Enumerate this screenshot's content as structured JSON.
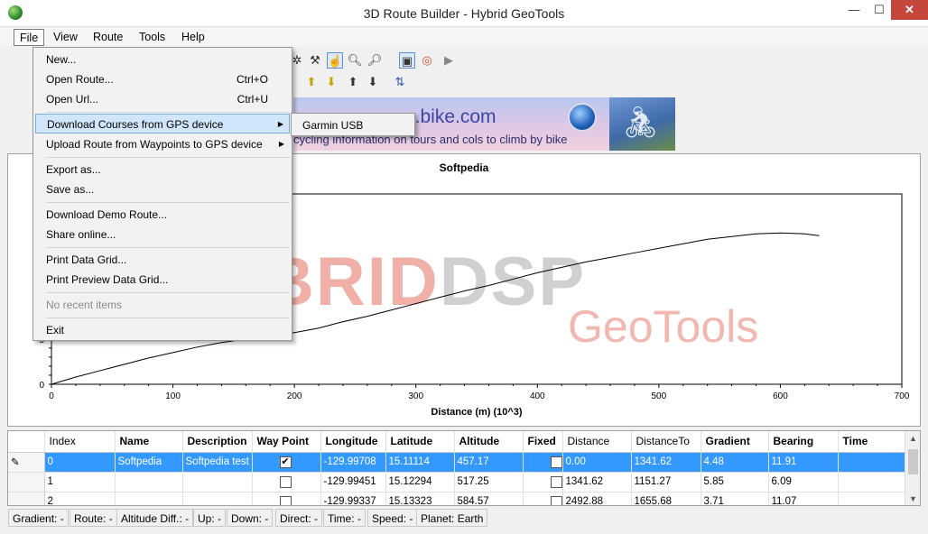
{
  "window": {
    "title": "3D Route Builder - Hybrid GeoTools",
    "min": "—",
    "max": "☐",
    "close": "✕"
  },
  "menubar": [
    "File",
    "View",
    "Route",
    "Tools",
    "Help"
  ],
  "file_menu": {
    "items": [
      {
        "label": "New...",
        "shortcut": ""
      },
      {
        "label": "Open Route...",
        "shortcut": "Ctrl+O"
      },
      {
        "label": "Open Url...",
        "shortcut": "Ctrl+U"
      },
      {
        "label": "Download Courses from GPS device",
        "shortcut": "",
        "submenu": true
      },
      {
        "label": "Upload Route from Waypoints to GPS device",
        "shortcut": "",
        "submenu": true
      },
      {
        "label": "Export as...",
        "shortcut": ""
      },
      {
        "label": "Save as...",
        "shortcut": ""
      },
      {
        "label": "Download Demo Route...",
        "shortcut": ""
      },
      {
        "label": "Share online...",
        "shortcut": ""
      },
      {
        "label": "Print Data Grid...",
        "shortcut": ""
      },
      {
        "label": "Print Preview Data Grid...",
        "shortcut": ""
      },
      {
        "label": "No recent items",
        "shortcut": "",
        "disabled": true
      },
      {
        "label": "Exit",
        "shortcut": ""
      }
    ],
    "submenu": {
      "label": "Garmin USB"
    }
  },
  "banner": {
    "title": "...bike.com",
    "subtitle": "cycling information on tours and cols to climb by bike"
  },
  "chart_data": {
    "type": "line",
    "title": "Softpedia",
    "xlabel": "Distance (m) (10^3)",
    "ylabel": "",
    "xlim": [
      0,
      700
    ],
    "ylim": [
      0,
      10
    ],
    "xticks": [
      0,
      100,
      200,
      300,
      400,
      500,
      600,
      700
    ],
    "yticks": [
      0,
      5
    ],
    "series": [
      {
        "x": [
          0,
          20,
          40,
          60,
          80,
          100,
          120,
          140,
          160,
          180,
          200,
          220,
          240,
          260,
          280,
          300,
          320,
          340,
          360,
          380,
          400,
          420,
          440,
          460,
          480,
          500,
          520,
          540,
          560,
          580,
          600,
          620,
          632
        ],
        "y": [
          0,
          0.8,
          1.5,
          2.2,
          2.9,
          3.5,
          4.1,
          4.6,
          5.0,
          5.3,
          5.7,
          6.2,
          6.9,
          7.5,
          8.2,
          8.9,
          9.6,
          10.3,
          10.9,
          11.6,
          12.3,
          12.9,
          13.5,
          14.0,
          14.5,
          15.0,
          15.5,
          16.0,
          16.3,
          16.6,
          16.7,
          16.6,
          16.4
        ]
      }
    ]
  },
  "grid": {
    "columns": [
      "Index",
      "Name",
      "Description",
      "Way Point",
      "Longitude",
      "Latitude",
      "Altitude",
      "Fixed",
      "Distance",
      "DistanceTo",
      "Gradient",
      "Bearing",
      "Time"
    ],
    "rows": [
      {
        "marker": "✎",
        "index": "0",
        "name": "Softpedia",
        "description": "Softpedia test",
        "waypoint": "✔",
        "longitude": "-129.99708",
        "latitude": "15.11114",
        "altitude": "457.17",
        "fixed": "",
        "distance": "0.00",
        "distanceto": "1341.62",
        "gradient": "4.48",
        "bearing": "11.91",
        "time": ""
      },
      {
        "marker": "",
        "index": "1",
        "name": "",
        "description": "",
        "waypoint": "",
        "longitude": "-129.99451",
        "latitude": "15.12294",
        "altitude": "517.25",
        "fixed": "",
        "distance": "1341.62",
        "distanceto": "1151.27",
        "gradient": "5.85",
        "bearing": "6.09",
        "time": ""
      },
      {
        "marker": "",
        "index": "2",
        "name": "",
        "description": "",
        "waypoint": "",
        "longitude": "-129.99337",
        "latitude": "15.13323",
        "altitude": "584.57",
        "fixed": "",
        "distance": "2492.88",
        "distanceto": "1655.68",
        "gradient": "3.71",
        "bearing": "11.07",
        "time": ""
      }
    ]
  },
  "status": [
    "Gradient: -",
    "Route: -",
    "Altitude Diff.: -",
    "Up: -",
    "Down: -",
    "Direct: -",
    "Time: -",
    "Speed: -",
    "Planet: Earth"
  ]
}
